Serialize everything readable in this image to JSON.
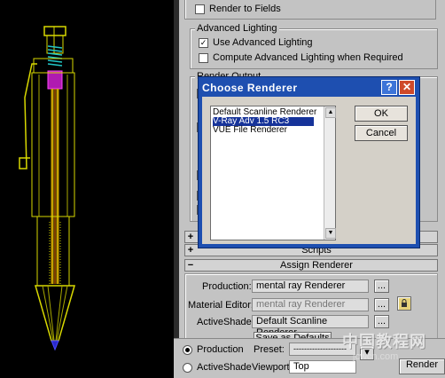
{
  "panel": {
    "render_to_fields": "Render to Fields",
    "advanced_lighting_header": "Advanced Lighting",
    "use_advanced_lighting": "Use Advanced Lighting",
    "compute_advanced_lighting": "Compute Advanced Lighting when Required",
    "render_output_header": "Render Output",
    "scripts_label": "Scripts",
    "assign_renderer_label": "Assign Renderer",
    "production_label": "Production:",
    "production_value": "mental ray Renderer",
    "material_editor_label": "Material Editor:",
    "material_editor_value": "mental ray Renderer",
    "activeshade_label": "ActiveShade:",
    "activeshade_value": "Default Scanline Renderer",
    "browse_glyph": "...",
    "save_defaults_label": "Save as Defaults"
  },
  "dialog": {
    "title": "Choose Renderer",
    "renderers": [
      "Default Scanline Renderer",
      "V-Ray Adv 1.5 RC3",
      "VUE File Renderer"
    ],
    "selected_index": 1,
    "ok_label": "OK",
    "cancel_label": "Cancel",
    "help_glyph": "?",
    "close_glyph": "✕"
  },
  "bottom": {
    "production_radio": "Production",
    "activeshade_radio": "ActiveShade",
    "preset_label": "Preset:",
    "preset_value": "--------------------",
    "viewport_label": "Viewport:",
    "viewport_value": "Top",
    "render_button_partial": "Render"
  },
  "watermark": {
    "line1": "中国教程网",
    "line2": "jcwcn.com"
  },
  "colors": {
    "dialog_title_bg": "#1e4fb0",
    "selection_bg": "#16339a",
    "close_button": "#cf4a2a",
    "panel_bg": "#c3c3c3",
    "viewport_bg": "#000000"
  }
}
